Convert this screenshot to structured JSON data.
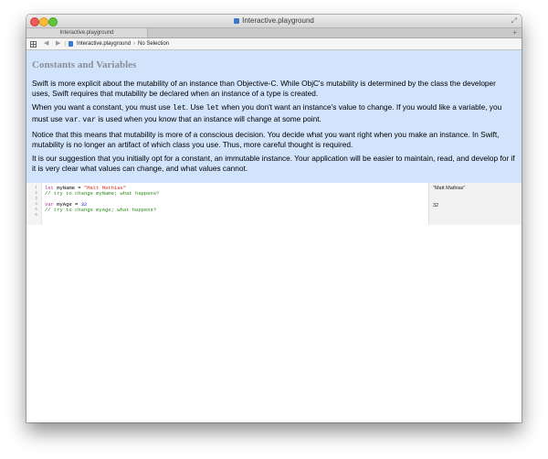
{
  "window": {
    "title": "Interactive.playground"
  },
  "tabs": [
    {
      "label": "Interactive.playground"
    }
  ],
  "jump_bar": {
    "file": "Interactive.playground",
    "separator": "›",
    "selection": "No Selection"
  },
  "documentation": {
    "title": "Constants and Variables",
    "paragraphs": {
      "p1": "Swift is more explicit about the mutability of an instance than Objective-C. While ObjC's mutability is determined by the class the developer uses, Swift requires that mutability be declared when an instance of a type is created.",
      "p2_a": "When you want a constant, you must use ",
      "p2_code1": "let",
      "p2_b": ". Use ",
      "p2_code2": "let",
      "p2_c": " when you don't want an instance's value to change. If you would like a variable, you must use ",
      "p2_code3": "var",
      "p2_d": ". ",
      "p2_code4": "var",
      "p2_e": " is used when you know that an instance will change at some point.",
      "p3": "Notice that this means that mutability is more of a conscious decision. You decide what you want right when you make an instance. In Swift, mutability is no longer an artifact of which class you use. Thus, more careful thought is required.",
      "p4": "It is our suggestion that you initially opt for a constant, an immutable instance. Your application will be easier to maintain, read, and develop for if it is very clear what values can change, and what values cannot."
    }
  },
  "editor": {
    "line_numbers": [
      "1",
      "2",
      "3",
      "4",
      "5",
      "6"
    ],
    "lines": {
      "l1_kw": "let",
      "l1_name": " myName = ",
      "l1_str": "\"Matt Mathias\"",
      "l2_cmt": "// try to change myName; what happens?",
      "l4_kw": "var",
      "l4_name": " myAge = ",
      "l4_num": "32",
      "l5_cmt": "// try to change myAge; what happens?"
    }
  },
  "results": {
    "r1": "\"Matt Mathias\"",
    "r4": "32"
  },
  "colors": {
    "doc_background": "#d1e4fb",
    "keyword": "#b8359d",
    "string": "#d12f1b",
    "number": "#272ad8",
    "comment": "#2f8a1d"
  }
}
